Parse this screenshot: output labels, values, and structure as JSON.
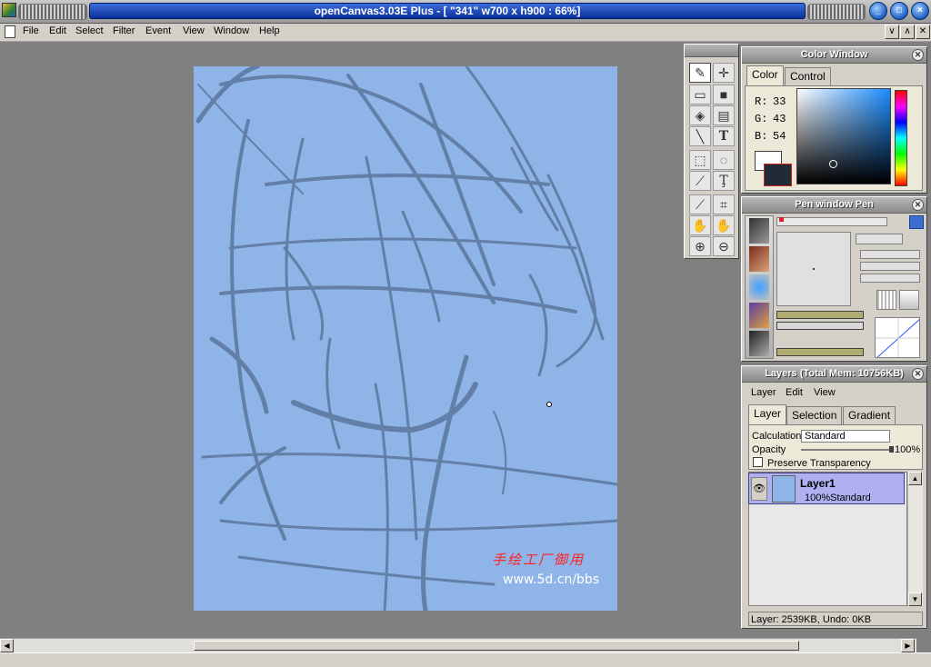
{
  "window": {
    "title": "openCanvas3.03E Plus - [ \"341\" w700 x h900 : 66%]"
  },
  "menu": [
    "File",
    "Edit",
    "Select",
    "Filter",
    "Event",
    "View",
    "Window",
    "Help"
  ],
  "mdi_buttons": [
    "∨",
    "∧",
    "✕"
  ],
  "canvas": {
    "watermark_cn": "手绘工厂御用",
    "watermark_url": "www.5d.cn/bbs"
  },
  "tools": [
    "pen-icon",
    "move-icon",
    "brush-icon",
    "fill-icon",
    "eraser-icon",
    "gradient-icon",
    "line-icon",
    "text-icon",
    "rect-select-icon",
    "lasso-icon",
    "magic-wand-icon",
    "text-select-icon",
    "dropper-icon",
    "crop-icon",
    "hand-icon",
    "rotate-icon",
    "zoom-in-icon",
    "zoom-out-icon"
  ],
  "color_window": {
    "title": "Color Window",
    "tabs": [
      "Color",
      "Control"
    ],
    "r_label": "R:",
    "r": "33",
    "g_label": "G:",
    "g": "43",
    "b_label": "B:",
    "b": "54",
    "current_color": "#212b36"
  },
  "pen_window": {
    "title": "Pen window  Pen"
  },
  "layers": {
    "title": "Layers (Total Mem: 10756KB)",
    "menu": [
      "Layer",
      "Edit",
      "View"
    ],
    "tabs": [
      "Layer",
      "Selection",
      "Gradient"
    ],
    "calculation_label": "Calculation",
    "calculation_value": "Standard",
    "opacity_label": "Opacity",
    "opacity_value": "100%",
    "preserve_label": "Preserve Transparency",
    "layer_name": "Layer1",
    "layer_info": "100%Standard",
    "status": "Layer: 2539KB, Undo: 0KB"
  }
}
